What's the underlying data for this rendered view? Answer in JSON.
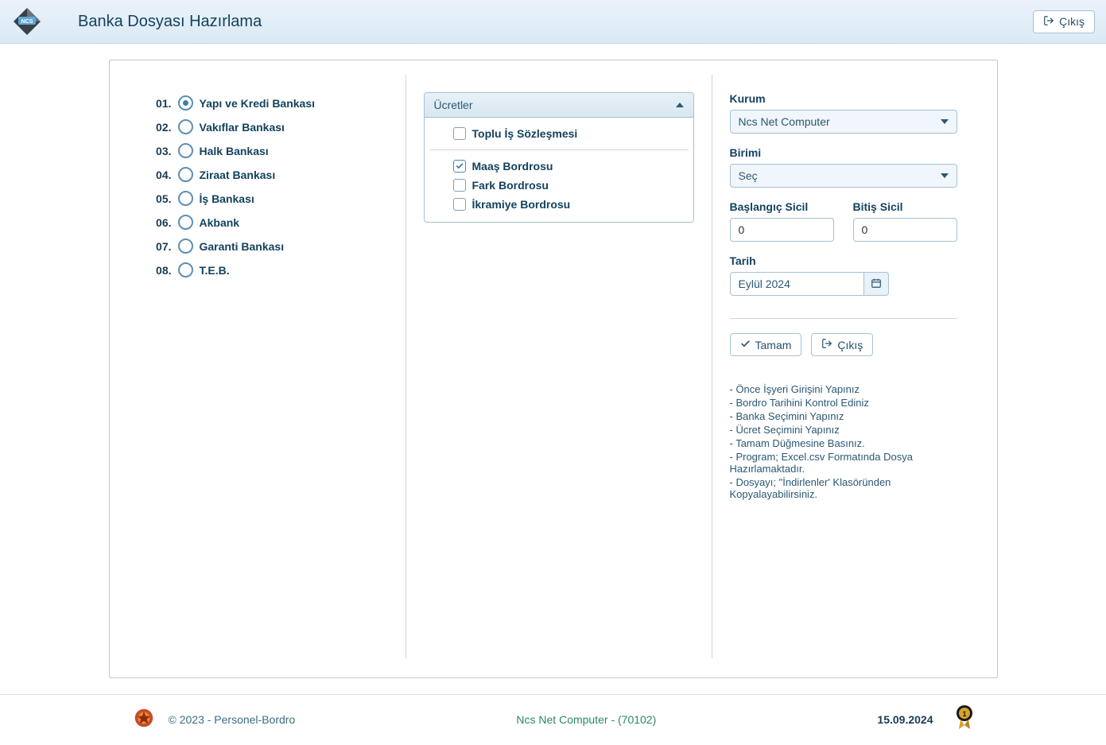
{
  "header": {
    "title": "Banka Dosyası Hazırlama",
    "exit_label": "Çıkış"
  },
  "banks": [
    {
      "num": "01.",
      "label": "Yapı ve Kredi Bankası",
      "selected": true
    },
    {
      "num": "02.",
      "label": "Vakıflar Bankası",
      "selected": false
    },
    {
      "num": "03.",
      "label": "Halk Bankası",
      "selected": false
    },
    {
      "num": "04.",
      "label": "Ziraat Bankası",
      "selected": false
    },
    {
      "num": "05.",
      "label": "İş Bankası",
      "selected": false
    },
    {
      "num": "06.",
      "label": "Akbank",
      "selected": false
    },
    {
      "num": "07.",
      "label": "Garanti Bankası",
      "selected": false
    },
    {
      "num": "08.",
      "label": "T.E.B.",
      "selected": false
    }
  ],
  "accordion": {
    "title": "Ücretler",
    "group1": [
      {
        "label": "Toplu İş Sözleşmesi",
        "checked": false
      }
    ],
    "group2": [
      {
        "label": "Maaş Bordrosu",
        "checked": true
      },
      {
        "label": "Fark Bordrosu",
        "checked": false
      },
      {
        "label": "İkramiye Bordrosu",
        "checked": false
      }
    ]
  },
  "form": {
    "kurum_label": "Kurum",
    "kurum_value": "Ncs Net Computer",
    "birim_label": "Birimi",
    "birim_value": "Seç",
    "bas_sicil_label": "Başlangıç Sicil",
    "bas_sicil_value": "0",
    "bit_sicil_label": "Bitiş Sicil",
    "bit_sicil_value": "0",
    "tarih_label": "Tarih",
    "tarih_value": "Eylül 2024",
    "ok_label": "Tamam",
    "exit_label": "Çıkış",
    "info": [
      "- Önce İşyeri Girişini Yapınız",
      "- Bordro Tarihini Kontrol Ediniz",
      "- Banka Seçimini Yapınız",
      "- Ücret Seçimini Yapınız",
      "- Tamam Düğmesine Basınız.",
      "- Program; Excel.csv Formatında Dosya Hazırlamaktadır.",
      "- Dosyayı; \"İndirlenler' Klasöründen Kopyalayabilirsiniz."
    ]
  },
  "footer": {
    "copyright": "© 2023 - Personel-Bordro",
    "company": "Ncs Net Computer - (70102)",
    "date": "15.09.2024"
  }
}
